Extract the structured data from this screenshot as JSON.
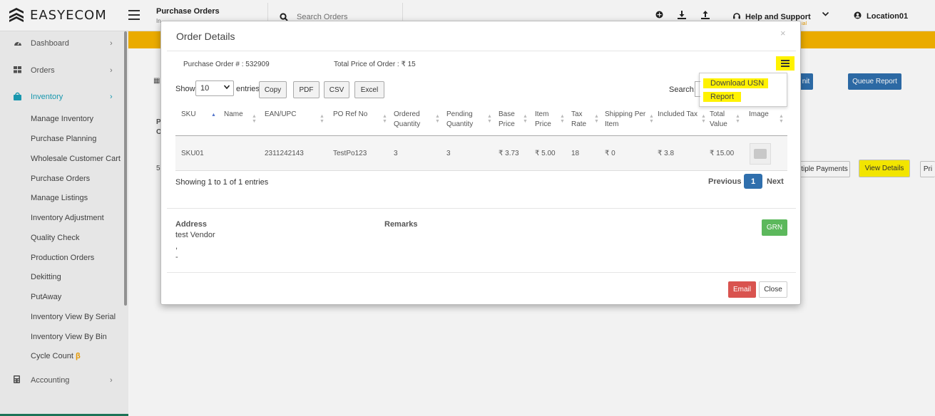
{
  "header": {
    "brand": "EASYECOM",
    "page_title": "Purchase Orders",
    "page_subtitle": "In",
    "search_placeholder": "Search Orders",
    "help_label": "Help and Support",
    "trial_text": "ial",
    "location_label": "Location01"
  },
  "sidebar": {
    "items": [
      {
        "label": "Dashboard",
        "icon": "dashboard-icon"
      },
      {
        "label": "Orders",
        "icon": "grid-icon"
      },
      {
        "label": "Inventory",
        "icon": "shopping-bag-icon",
        "active": true
      },
      {
        "label": "Accounting",
        "icon": "calculator-icon"
      }
    ],
    "inventory_sub": [
      "Manage Inventory",
      "Purchase Planning",
      "Wholesale Customer Cart",
      "Purchase Orders",
      "Manage Listings",
      "Inventory Adjustment",
      "Quality Check",
      "Production Orders",
      "Dekitting",
      "PutAway",
      "Inventory View By Serial",
      "Inventory View By Bin",
      "Cycle Count"
    ],
    "beta_mark": "β",
    "accent": "#1aa0b8"
  },
  "background": {
    "submit_label": "nit",
    "queue_report_label": "Queue Report",
    "multiple_payments_label": "tiple Payments",
    "view_details_label": "View Details",
    "print_label": "Pri",
    "bg_col_a": "P",
    "bg_col_b": "O",
    "bg_cell": "5",
    "band_color": "#f7b500"
  },
  "modal": {
    "title": "Order Details",
    "close_glyph": "×",
    "po_number_label": "Purchase Order # :",
    "po_number": "532909",
    "total_price_label": "Total Price of Order :",
    "total_price": "₹ 15",
    "menu": {
      "items": [
        "Download USN",
        "Report"
      ]
    },
    "show_label": "Show",
    "page_size": "10",
    "entries_label": "entries",
    "export_buttons": [
      "Copy",
      "PDF",
      "CSV",
      "Excel"
    ],
    "search_label": "Search:",
    "table": {
      "columns": [
        [
          "SKU"
        ],
        [
          "Name"
        ],
        [
          "EAN/UPC"
        ],
        [
          "PO Ref No"
        ],
        [
          "Ordered",
          "Quantity"
        ],
        [
          "Pending",
          "Quantity"
        ],
        [
          "Base",
          "Price"
        ],
        [
          "Item",
          "Price"
        ],
        [
          "Tax",
          "Rate"
        ],
        [
          "Shipping Per",
          "Item"
        ],
        [
          "Included Tax"
        ],
        [
          "Total",
          "Value"
        ],
        [
          "Image"
        ]
      ],
      "rows": [
        [
          "SKU01",
          "",
          "2311242143",
          "TestPo123",
          "3",
          "3",
          "₹ 3.73",
          "₹ 5.00",
          "18",
          "₹ 0",
          "₹ 3.8",
          "₹ 15.00",
          ""
        ]
      ]
    },
    "showing_text": "Showing 1 to 1 of 1 entries",
    "pager": {
      "previous": "Previous",
      "current": "1",
      "next": "Next"
    },
    "address_label": "Address",
    "address_lines": [
      "test Vendor",
      ",",
      "-"
    ],
    "remarks_label": "Remarks",
    "grn_label": "GRN",
    "email_label": "Email",
    "close_label": "Close"
  }
}
